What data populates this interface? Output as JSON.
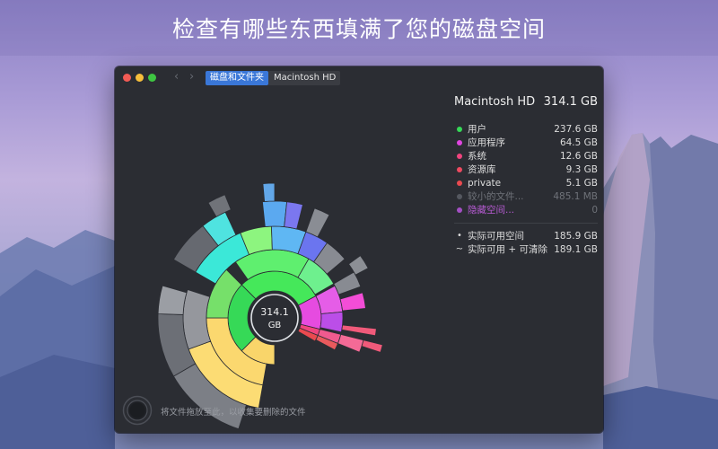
{
  "headline": "检查有哪些东西填满了您的磁盘空间",
  "window": {
    "breadcrumb": [
      "磁盘和文件夹",
      "Macintosh HD"
    ],
    "nav": {
      "back_icon": "‹",
      "forward_icon": "›"
    }
  },
  "chart_center": {
    "size": "314.1",
    "unit": "GB"
  },
  "disk": {
    "name": "Macintosh HD",
    "size": "314.1 GB"
  },
  "legend": [
    {
      "name": "用户",
      "size": "237.6 GB",
      "color": "#36d957"
    },
    {
      "name": "应用程序",
      "size": "64.5 GB",
      "color": "#e046e0"
    },
    {
      "name": "系统",
      "size": "12.6 GB",
      "color": "#f0447e"
    },
    {
      "name": "资源库",
      "size": "9.3 GB",
      "color": "#ee4a60"
    },
    {
      "name": "private",
      "size": "5.1 GB",
      "color": "#ea4a50"
    },
    {
      "name": "较小的文件...",
      "size": "485.1 MB",
      "color": "#555860"
    },
    {
      "name": "隐藏空间...",
      "size": "0",
      "color": "#a34fc4"
    }
  ],
  "space": [
    {
      "symbol": "•",
      "label": "实际可用空间",
      "size": "185.9 GB"
    },
    {
      "symbol": "~",
      "label": "实际可用 + 可清除",
      "size": "189.1 GB"
    }
  ],
  "dropzone": {
    "text": "将文件拖放至此，以收集要删除的文件"
  }
}
